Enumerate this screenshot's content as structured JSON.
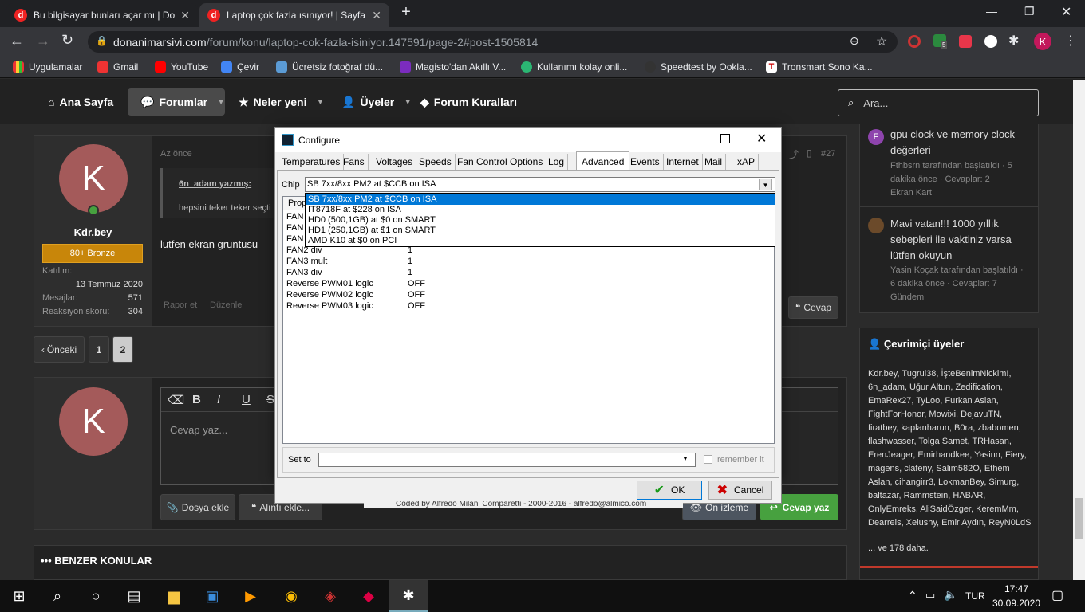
{
  "browser": {
    "tabs": [
      {
        "title": "Bu bilgisayar bunları açar mı | Do",
        "active": false
      },
      {
        "title": "Laptop çok fazla ısınıyor! | Sayfa 2",
        "active": true
      }
    ],
    "new_tab": "+",
    "url_host": "donanimarsivi.com",
    "url_path": "/forum/konu/laptop-cok-fazla-isiniyor.147591/page-2#post-1505814",
    "profile_initial": "K",
    "extension_badge": "5",
    "bookmarks": [
      "Uygulamalar",
      "Gmail",
      "YouTube",
      "Çevir",
      "Ücretsiz fotoğraf dü...",
      "Magisto'dan Akıllı V...",
      "Kullanımı kolay onli...",
      "Speedtest by Ookla...",
      "Tronsmart Sono Ka..."
    ]
  },
  "nav": {
    "items": [
      "Ana Sayfa",
      "Forumlar",
      "Neler yeni",
      "Üyeler",
      "Forum Kuralları"
    ],
    "search_placeholder": "Ara..."
  },
  "post": {
    "time": "Az önce",
    "number": "#27",
    "quote_author": "6n_adam yazmış:",
    "quote_text": "hepsini teker teker seçti",
    "body": "lutfen ekran gruntusu",
    "report": "Rapor et",
    "edit": "Düzenle",
    "reply": "Cevap"
  },
  "user": {
    "initial": "K",
    "name": "Kdr.bey",
    "rank": "80+ Bronze",
    "joined_label": "Katılım:",
    "joined": "13 Temmuz 2020",
    "messages_label": "Mesajlar:",
    "messages": "571",
    "reaction_label": "Reaksiyon skoru:",
    "reaction": "304"
  },
  "pagination": {
    "prev": "Önceki",
    "pages": [
      "1",
      "2"
    ]
  },
  "reply_box": {
    "placeholder": "Cevap yaz...",
    "attach": "Dosya ekle",
    "quote": "Alıntı ekle...",
    "preview": "Ön izleme",
    "submit": "Cevap yaz",
    "fmt": [
      "B",
      "I",
      "U",
      "S"
    ]
  },
  "similar_title": "BENZER KONULAR",
  "sidebar": {
    "threads": [
      {
        "avatar": "F",
        "title": "gpu clock ve memory clock değerleri",
        "meta1": "Fthbsrn tarafından başlatıldı · 5",
        "meta2": "dakika önce · Cevaplar: 2",
        "forum": "Ekran Kartı"
      },
      {
        "avatar": "",
        "title": "Mavi vatan!!! 1000 yıllık sebepleri ile vaktiniz varsa lütfen okuyun",
        "meta1": "Yasin Koçak tarafından başlatıldı ·",
        "meta2": "6 dakika önce · Cevaplar: 7",
        "forum": "Gündem"
      }
    ],
    "online_title": "Çevrimiçi üyeler",
    "online_list": "Kdr.bey, Tugrul38, İşteBenimNickim!, 6n_adam, Uğur Altun, Zedification, EmaRex27, TyLoo, Furkan Aslan, FightForHonor, Mowixi, DejavuTN, firatbey, kaplanharun, B0ra, zbabomen, flashwasser, Tolga Samet, TRHasan, ErenJeager, Emirhandkee, Yasinn, Fiery, magens, clafeny, Salim582O, Ethem Aslan, cihangirr3, LokmanBey, Simurg, baltazar, Rammstein, HABAR, OnlyEmreks, AliSaidÖzger, KeremMm, Dearreis, Xelushy, Emir Aydın, ReyN0LdS",
    "online_more": "... ve 178 daha."
  },
  "dialog": {
    "title": "Configure",
    "tabs": [
      "Temperatures",
      "Fans",
      "Voltages",
      "Speeds",
      "Fan Control",
      "Options",
      "Log",
      "Advanced",
      "Events",
      "Internet",
      "Mail",
      "xAP"
    ],
    "active_tab": "Advanced",
    "chip_label": "Chip",
    "chip_value": "SB 7xx/8xx PM2 at $CCB on ISA",
    "chip_options": [
      "SB 7xx/8xx PM2 at $CCB on ISA",
      "IT8718F at $228 on ISA",
      "HD0 (500,1GB) at $0 on SMART",
      "HD1 (250,1GB) at $1 on SMART",
      "AMD K10 at $0 on PCI"
    ],
    "col_header": "Prop",
    "hidden_rows": [
      "FAN",
      "FAN",
      "FAN"
    ],
    "rows": [
      {
        "name": "FAN2 div",
        "value": "1"
      },
      {
        "name": "FAN3 mult",
        "value": "1"
      },
      {
        "name": "FAN3 div",
        "value": "1"
      },
      {
        "name": "Reverse PWM01 logic",
        "value": "OFF"
      },
      {
        "name": "Reverse PWM02 logic",
        "value": "OFF"
      },
      {
        "name": "Reverse PWM03 logic",
        "value": "OFF"
      }
    ],
    "set_to_label": "Set to",
    "remember": "remember it",
    "ok": "OK",
    "cancel": "Cancel",
    "footer_text": "Coded by Alfredo Milani Comparetti - 2000-2016 - alfredo@almico.com"
  },
  "taskbar": {
    "lang": "TUR",
    "time": "17:47",
    "date": "30.09.2020"
  },
  "colors": {
    "accent_green": "#47a13f",
    "bronze": "#c8860a",
    "avatar": "#a45a5a",
    "selection": "#0078d7"
  }
}
